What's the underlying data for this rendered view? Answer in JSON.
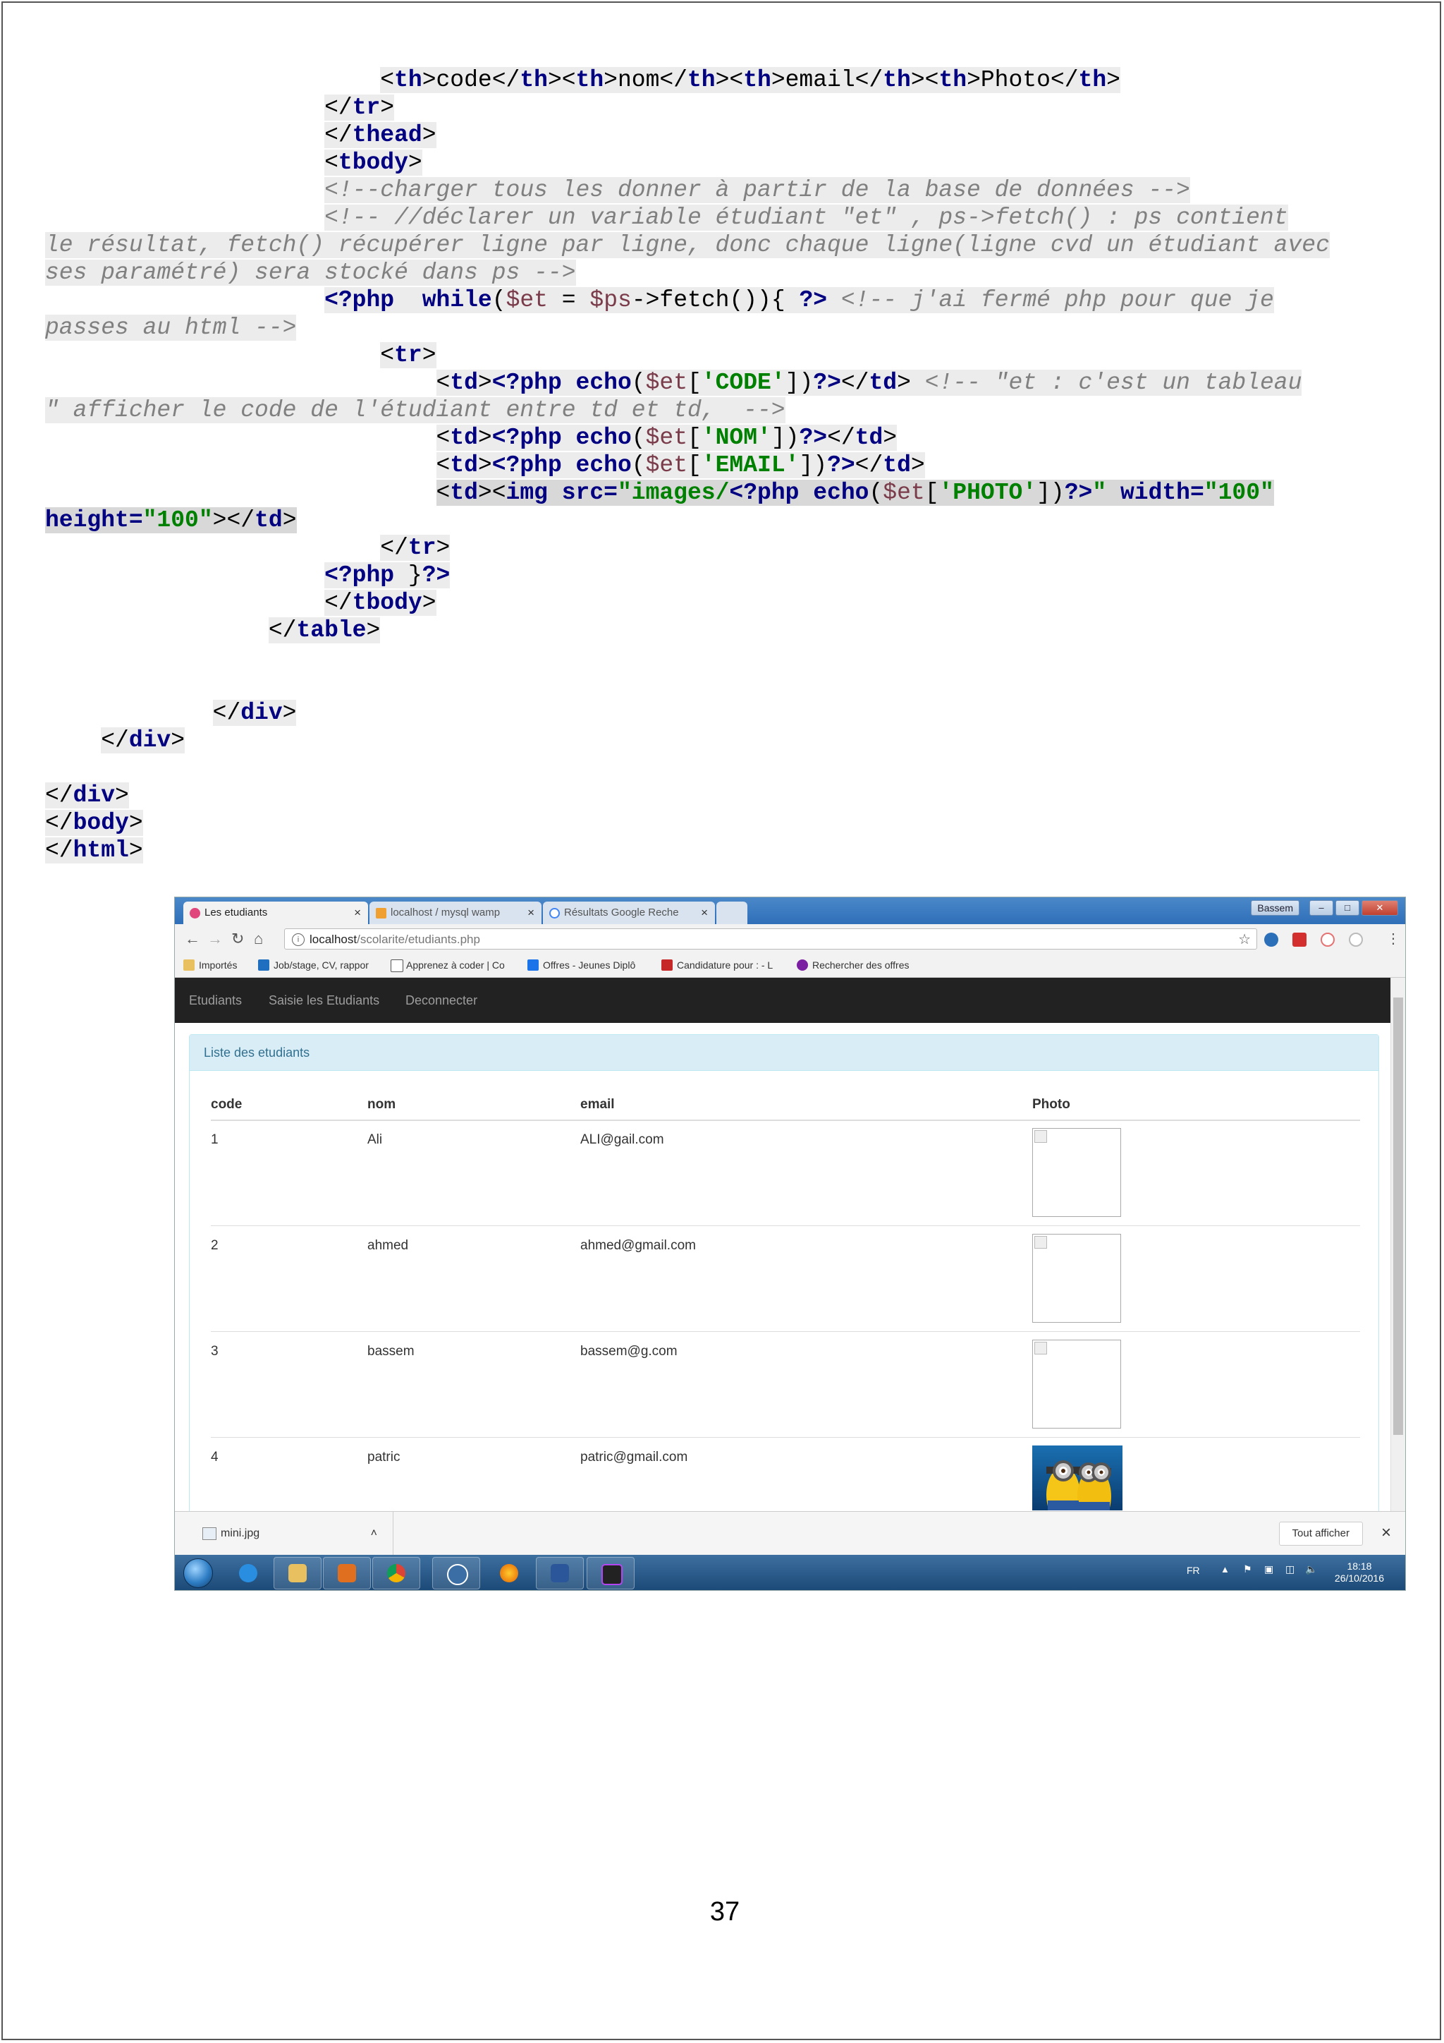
{
  "code_lines": [
    {
      "indent": "                        ",
      "parts": [
        {
          "c": "",
          "t": "<"
        },
        {
          "c": "t",
          "t": "th"
        },
        {
          "c": "",
          "t": ">code</"
        },
        {
          "c": "t",
          "t": "th"
        },
        {
          "c": "",
          "t": "><"
        },
        {
          "c": "t",
          "t": "th"
        },
        {
          "c": "",
          "t": ">nom</"
        },
        {
          "c": "t",
          "t": "th"
        },
        {
          "c": "",
          "t": "><"
        },
        {
          "c": "t",
          "t": "th"
        },
        {
          "c": "",
          "t": ">email</"
        },
        {
          "c": "t",
          "t": "th"
        },
        {
          "c": "",
          "t": "><"
        },
        {
          "c": "t",
          "t": "th"
        },
        {
          "c": "",
          "t": ">Photo</"
        },
        {
          "c": "t",
          "t": "th"
        },
        {
          "c": "",
          "t": ">"
        }
      ]
    },
    {
      "indent": "                    ",
      "parts": [
        {
          "c": "",
          "t": "</"
        },
        {
          "c": "t",
          "t": "tr"
        },
        {
          "c": "",
          "t": ">"
        }
      ]
    },
    {
      "indent": "                    ",
      "parts": [
        {
          "c": "",
          "t": "</"
        },
        {
          "c": "t",
          "t": "thead"
        },
        {
          "c": "",
          "t": ">"
        }
      ]
    },
    {
      "indent": "                    ",
      "parts": [
        {
          "c": "",
          "t": "<"
        },
        {
          "c": "t",
          "t": "tbody"
        },
        {
          "c": "",
          "t": ">"
        }
      ]
    },
    {
      "indent": "                    ",
      "parts": [
        {
          "c": "c",
          "t": "<!--charger tous les donner à partir de la base de données -->"
        }
      ]
    },
    {
      "indent": "                    ",
      "parts": [
        {
          "c": "c",
          "t": "<!-- //déclarer un variable étudiant \"et\" , ps->fetch() : ps contient"
        }
      ]
    },
    {
      "indent": "",
      "parts": [
        {
          "c": "c",
          "t": "le résultat, fetch() récupérer ligne par ligne, donc chaque ligne(ligne cvd un étudiant avec"
        }
      ]
    },
    {
      "indent": "",
      "parts": [
        {
          "c": "c",
          "t": "ses paramétré) sera stocké dans ps -->"
        }
      ]
    },
    {
      "indent": "                    ",
      "parts": [
        {
          "c": "t",
          "t": "<?php"
        },
        {
          "c": "",
          "t": "  "
        },
        {
          "c": "t",
          "t": "while"
        },
        {
          "c": "",
          "t": "("
        },
        {
          "c": "v",
          "t": "$et"
        },
        {
          "c": "",
          "t": " = "
        },
        {
          "c": "v",
          "t": "$ps"
        },
        {
          "c": "",
          "t": "->fetch()){ "
        },
        {
          "c": "t",
          "t": "?>"
        },
        {
          "c": "",
          "t": " "
        },
        {
          "c": "c",
          "t": "<!-- j'ai fermé php pour que je"
        }
      ]
    },
    {
      "indent": "",
      "parts": [
        {
          "c": "c",
          "t": "passes au html -->"
        }
      ]
    },
    {
      "indent": "                        ",
      "parts": [
        {
          "c": "",
          "t": "<"
        },
        {
          "c": "t",
          "t": "tr"
        },
        {
          "c": "",
          "t": ">"
        }
      ]
    },
    {
      "indent": "                            ",
      "parts": [
        {
          "c": "",
          "t": "<"
        },
        {
          "c": "t",
          "t": "td"
        },
        {
          "c": "",
          "t": ">"
        },
        {
          "c": "t",
          "t": "<?php echo"
        },
        {
          "c": "",
          "t": "("
        },
        {
          "c": "v",
          "t": "$et"
        },
        {
          "c": "",
          "t": "["
        },
        {
          "c": "s",
          "t": "'CODE'"
        },
        {
          "c": "",
          "t": "])"
        },
        {
          "c": "t",
          "t": "?>"
        },
        {
          "c": "",
          "t": "</"
        },
        {
          "c": "t",
          "t": "td"
        },
        {
          "c": "",
          "t": "> "
        },
        {
          "c": "c",
          "t": "<!-- \"et : c'est un tableau"
        }
      ]
    },
    {
      "indent": "",
      "parts": [
        {
          "c": "c",
          "t": "\" afficher le code de l'étudiant entre td et td,  -->"
        }
      ]
    },
    {
      "indent": "                            ",
      "parts": [
        {
          "c": "",
          "t": "<"
        },
        {
          "c": "t",
          "t": "td"
        },
        {
          "c": "",
          "t": ">"
        },
        {
          "c": "t",
          "t": "<?php echo"
        },
        {
          "c": "",
          "t": "("
        },
        {
          "c": "v",
          "t": "$et"
        },
        {
          "c": "",
          "t": "["
        },
        {
          "c": "s",
          "t": "'NOM'"
        },
        {
          "c": "",
          "t": "])"
        },
        {
          "c": "t",
          "t": "?>"
        },
        {
          "c": "",
          "t": "</"
        },
        {
          "c": "t",
          "t": "td"
        },
        {
          "c": "",
          "t": ">"
        }
      ]
    },
    {
      "indent": "                            ",
      "parts": [
        {
          "c": "",
          "t": "<"
        },
        {
          "c": "t",
          "t": "td"
        },
        {
          "c": "",
          "t": ">"
        },
        {
          "c": "t",
          "t": "<?php echo"
        },
        {
          "c": "",
          "t": "("
        },
        {
          "c": "v",
          "t": "$et"
        },
        {
          "c": "",
          "t": "["
        },
        {
          "c": "s",
          "t": "'EMAIL'"
        },
        {
          "c": "",
          "t": "])"
        },
        {
          "c": "t",
          "t": "?>"
        },
        {
          "c": "",
          "t": "</"
        },
        {
          "c": "t",
          "t": "td"
        },
        {
          "c": "",
          "t": ">"
        }
      ]
    },
    {
      "indent": "                            ",
      "hl": true,
      "parts": [
        {
          "c": "",
          "t": "<"
        },
        {
          "c": "t",
          "t": "td"
        },
        {
          "c": "",
          "t": "><"
        },
        {
          "c": "t",
          "t": "img src="
        },
        {
          "c": "s",
          "t": "\"images/"
        },
        {
          "c": "t",
          "t": "<?php echo"
        },
        {
          "c": "",
          "t": "("
        },
        {
          "c": "v",
          "t": "$et"
        },
        {
          "c": "",
          "t": "["
        },
        {
          "c": "s",
          "t": "'PHOTO'"
        },
        {
          "c": "",
          "t": "])"
        },
        {
          "c": "t",
          "t": "?>"
        },
        {
          "c": "s",
          "t": "\""
        },
        {
          "c": "",
          "t": " "
        },
        {
          "c": "t",
          "t": "width="
        },
        {
          "c": "s",
          "t": "\"100\""
        }
      ]
    },
    {
      "indent": "",
      "hl": true,
      "parts": [
        {
          "c": "t",
          "t": "height="
        },
        {
          "c": "s",
          "t": "\"100\""
        },
        {
          "c": "",
          "t": "></"
        },
        {
          "c": "t",
          "t": "td"
        },
        {
          "c": "",
          "t": ">"
        }
      ]
    },
    {
      "indent": "                        ",
      "parts": [
        {
          "c": "",
          "t": "</"
        },
        {
          "c": "t",
          "t": "tr"
        },
        {
          "c": "",
          "t": ">"
        }
      ]
    },
    {
      "indent": "                    ",
      "parts": [
        {
          "c": "t",
          "t": "<?php"
        },
        {
          "c": "",
          "t": " }"
        },
        {
          "c": "t",
          "t": "?>"
        }
      ]
    },
    {
      "indent": "                    ",
      "parts": [
        {
          "c": "",
          "t": "</"
        },
        {
          "c": "t",
          "t": "tbody"
        },
        {
          "c": "",
          "t": ">"
        }
      ]
    },
    {
      "indent": "                ",
      "parts": [
        {
          "c": "",
          "t": "</"
        },
        {
          "c": "t",
          "t": "table"
        },
        {
          "c": "",
          "t": ">"
        }
      ]
    },
    {
      "indent": "",
      "parts": []
    },
    {
      "indent": "",
      "parts": []
    },
    {
      "indent": "            ",
      "parts": [
        {
          "c": "",
          "t": "</"
        },
        {
          "c": "t",
          "t": "div"
        },
        {
          "c": "",
          "t": ">"
        }
      ]
    },
    {
      "indent": "    ",
      "parts": [
        {
          "c": "",
          "t": "</"
        },
        {
          "c": "t",
          "t": "div"
        },
        {
          "c": "",
          "t": ">"
        }
      ]
    },
    {
      "indent": "",
      "parts": []
    },
    {
      "indent": "",
      "parts": [
        {
          "c": "",
          "t": "</"
        },
        {
          "c": "t",
          "t": "div"
        },
        {
          "c": "",
          "t": ">"
        }
      ]
    },
    {
      "indent": "",
      "parts": [
        {
          "c": "",
          "t": "</"
        },
        {
          "c": "t",
          "t": "body"
        },
        {
          "c": "",
          "t": ">"
        }
      ]
    },
    {
      "indent": "",
      "parts": [
        {
          "c": "",
          "t": "</"
        },
        {
          "c": "t",
          "t": "html"
        },
        {
          "c": "",
          "t": ">"
        }
      ]
    }
  ],
  "browser": {
    "tabs": [
      {
        "label": "Les etudiants",
        "active": true
      },
      {
        "label": "localhost / mysql wamp",
        "active": false
      },
      {
        "label": "Résultats Google Reche",
        "active": false
      }
    ],
    "user_badge": "Bassem",
    "url_host": "localhost",
    "url_path": "/scolarite/etudiants.php",
    "bookmarks": [
      "Importés",
      "Job/stage, CV, rappor",
      "Apprenez à coder | Co",
      "Offres - Jeunes Diplô",
      "Candidature pour : - L",
      "Rechercher des offres"
    ]
  },
  "app": {
    "nav": [
      "Etudiants",
      "Saisie les Etudiants",
      "Deconnecter"
    ],
    "panel_title": "Liste des etudiants",
    "columns": [
      "code",
      "nom",
      "email",
      "Photo"
    ],
    "rows": [
      {
        "code": "1",
        "nom": "Ali",
        "email": "ALI@gail.com"
      },
      {
        "code": "2",
        "nom": "ahmed",
        "email": "ahmed@gmail.com"
      },
      {
        "code": "3",
        "nom": "bassem",
        "email": "bassem@g.com"
      },
      {
        "code": "4",
        "nom": "patric",
        "email": "patric@gmail.com"
      }
    ]
  },
  "download": {
    "file": "mini.jpg",
    "show_all": "Tout afficher"
  },
  "taskbar": {
    "lang": "FR",
    "time": "18:18",
    "date": "26/10/2016"
  },
  "page_number": "37"
}
